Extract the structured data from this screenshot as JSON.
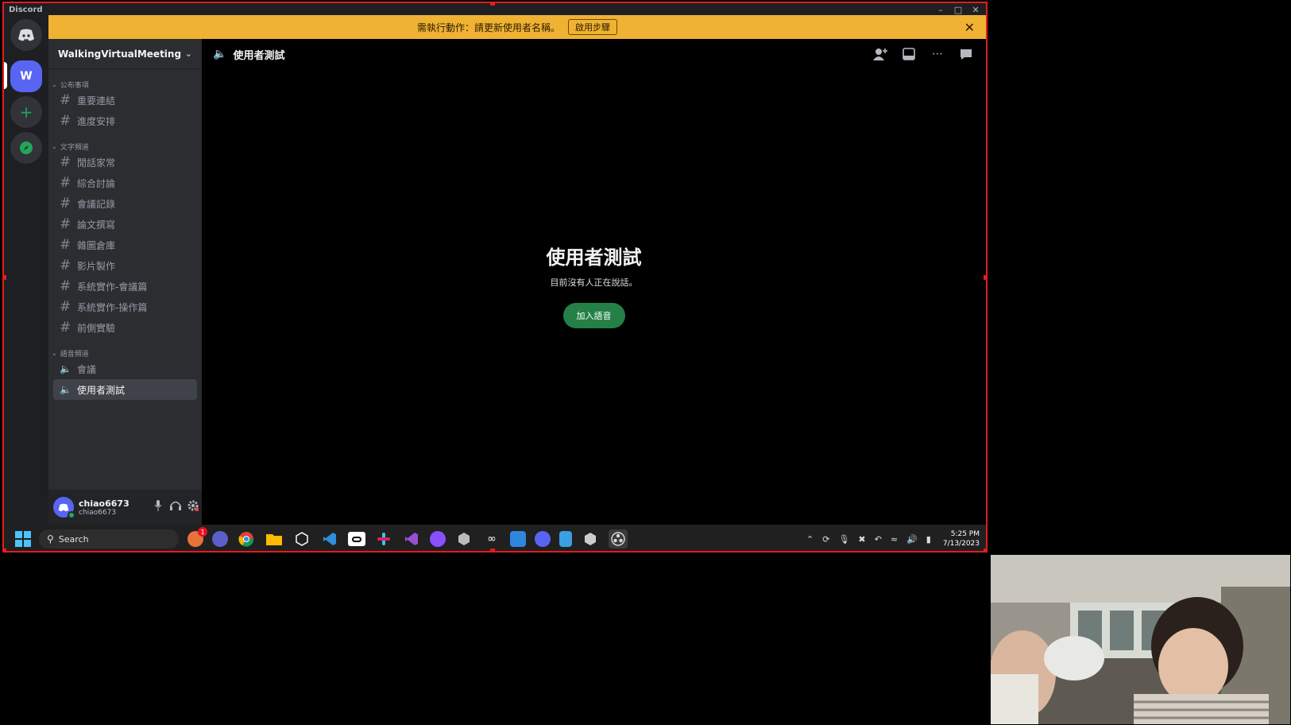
{
  "window": {
    "app_name": "Discord",
    "minimize_icon": "minimize-icon",
    "maximize_icon": "maximize-icon",
    "close_icon": "close-icon"
  },
  "notice": {
    "text": "需執行動作：請更新使用者名稱。",
    "button": "啟用步驟"
  },
  "rail": {
    "server_initial": "W",
    "add_label": "+",
    "explore_icon": "compass-icon"
  },
  "server": {
    "name": "WalkingVirtualMeeting"
  },
  "categories": [
    {
      "name": "公布事項",
      "channels": [
        "重要連結",
        "進度安排"
      ]
    },
    {
      "name": "文字頻道",
      "channels": [
        "閒話家常",
        "綜合討論",
        "會議記錄",
        "論文撰寫",
        "雜圖倉庫",
        "影片製作",
        "系統實作-會議篇",
        "系統實作-操作篇",
        "前側實驗"
      ]
    },
    {
      "name": "語音頻道",
      "channels": [
        "會議",
        "使用者測試"
      ]
    }
  ],
  "user": {
    "name": "chiao6673",
    "tag": "chiao6673"
  },
  "channel_header": {
    "title": "使用者測試"
  },
  "voice_panel": {
    "title": "使用者測試",
    "subtitle": "目前沒有人正在說話。",
    "join_button": "加入語音"
  },
  "taskbar": {
    "search_placeholder": "Search",
    "time": "5:25 PM",
    "date": "7/13/2023",
    "badge": "1"
  },
  "colors": {
    "accent": "#5865f2",
    "notice": "#f0b232",
    "join": "#248046",
    "highlight": "#e31c1c"
  }
}
